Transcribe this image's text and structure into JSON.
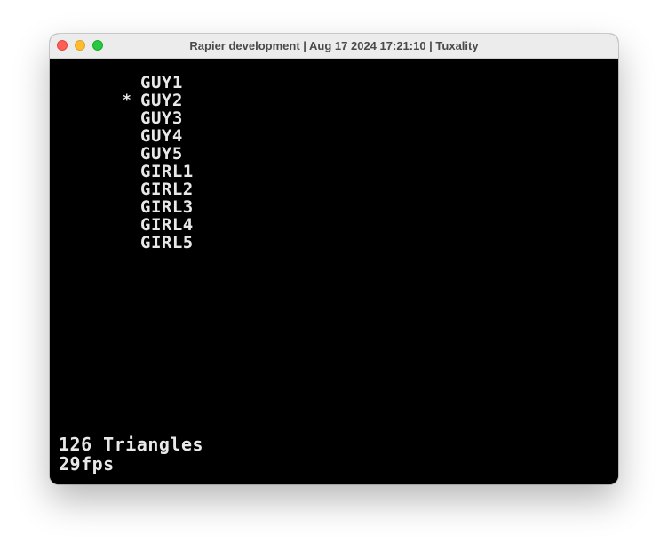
{
  "window": {
    "title": "Rapier development | Aug 17 2024 17:21:10 | Tuxality"
  },
  "menu": {
    "cursor": "*",
    "selected_index": 1,
    "items": [
      {
        "label": "GUY1"
      },
      {
        "label": "GUY2"
      },
      {
        "label": "GUY3"
      },
      {
        "label": "GUY4"
      },
      {
        "label": "GUY5"
      },
      {
        "label": "GIRL1"
      },
      {
        "label": "GIRL2"
      },
      {
        "label": "GIRL3"
      },
      {
        "label": "GIRL4"
      },
      {
        "label": "GIRL5"
      }
    ]
  },
  "hud": {
    "triangles": "126 Triangles",
    "fps": "29fps"
  },
  "colors": {
    "background": "#000000",
    "text": "#e8e8e8",
    "titlebar": "#ececec"
  }
}
